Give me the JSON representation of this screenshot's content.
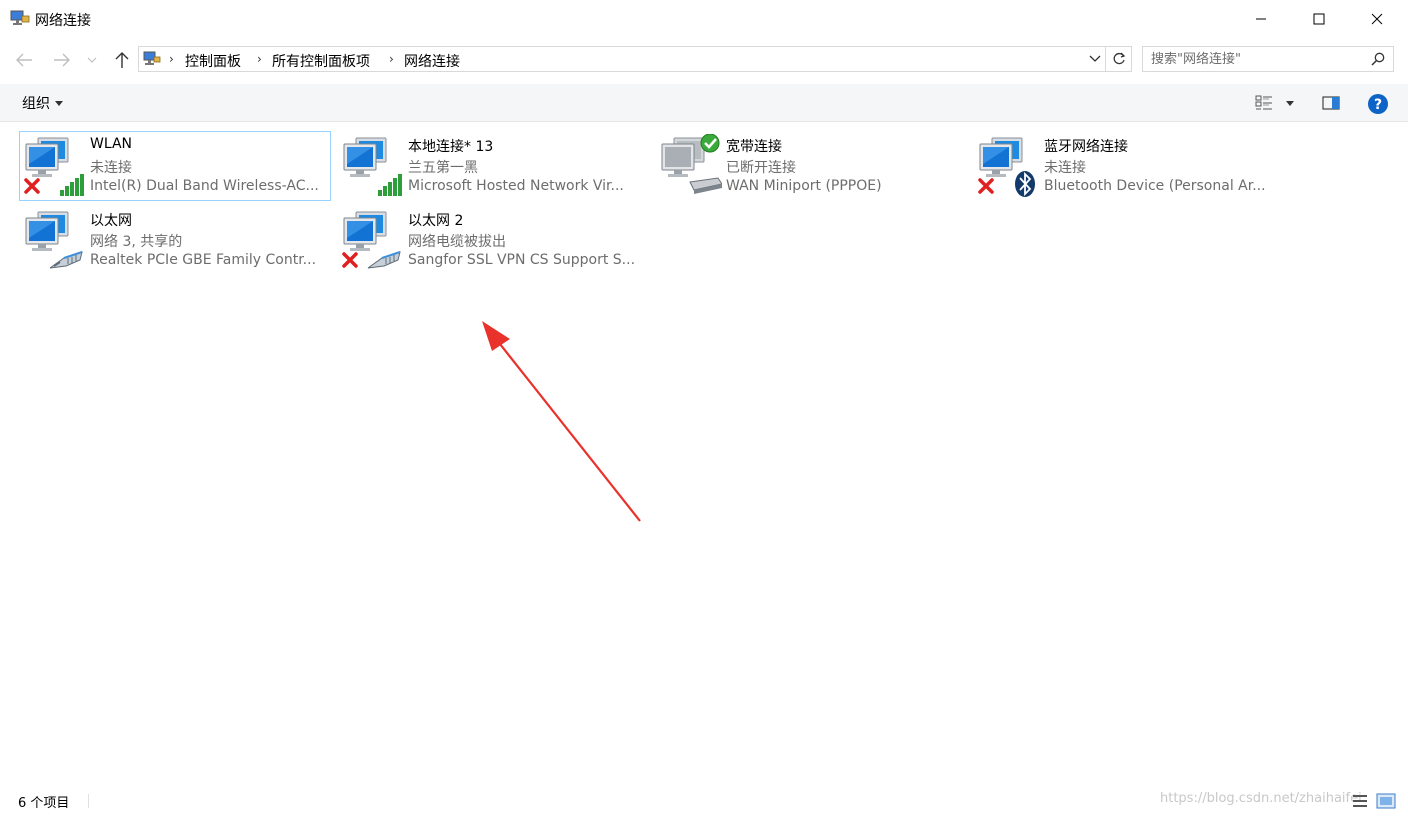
{
  "window": {
    "title": "网络连接"
  },
  "address": {
    "crumbs": [
      "控制面板",
      "所有控制面板项",
      "网络连接"
    ]
  },
  "search": {
    "placeholder": "搜索\"网络连接\""
  },
  "toolbar": {
    "organize_label": "组织"
  },
  "connections": [
    {
      "name": "WLAN",
      "status": "未连接",
      "device": "Intel(R) Dual Band Wireless-AC...",
      "icon": "wifi-adapter-icon",
      "badge": "disconnected-x-icon",
      "selected": true
    },
    {
      "name": "本地连接* 13",
      "status": "兰五第一黑",
      "device": "Microsoft Hosted Network Vir...",
      "icon": "wifi-adapter-icon",
      "badge": "",
      "selected": false
    },
    {
      "name": "宽带连接",
      "status": "已断开连接",
      "device": "WAN Miniport (PPPOE)",
      "icon": "broadband-modem-icon",
      "badge": "checkmark-icon",
      "selected": false
    },
    {
      "name": "蓝牙网络连接",
      "status": "未连接",
      "device": "Bluetooth Device (Personal Ar...",
      "icon": "bluetooth-adapter-icon",
      "badge": "disconnected-x-icon",
      "selected": false
    },
    {
      "name": "以太网",
      "status": "网络  3, 共享的",
      "device": "Realtek PCIe GBE Family Contr...",
      "icon": "ethernet-adapter-icon",
      "badge": "",
      "selected": false
    },
    {
      "name": "以太网 2",
      "status": "网络电缆被拔出",
      "device": "Sangfor SSL VPN CS Support S...",
      "icon": "ethernet-adapter-icon",
      "badge": "disconnected-x-icon",
      "selected": false
    }
  ],
  "status": {
    "item_count": "6 个项目",
    "watermark": "https://blog.csdn.net/zhaihaifei"
  },
  "colors": {
    "accent": "#0078d7",
    "selection_border": "#99d1ff",
    "secondary_text": "#6d6d6d",
    "error_red": "#e02020",
    "signal_green": "#2e9e3c",
    "arrow_red": "#e8322b"
  }
}
